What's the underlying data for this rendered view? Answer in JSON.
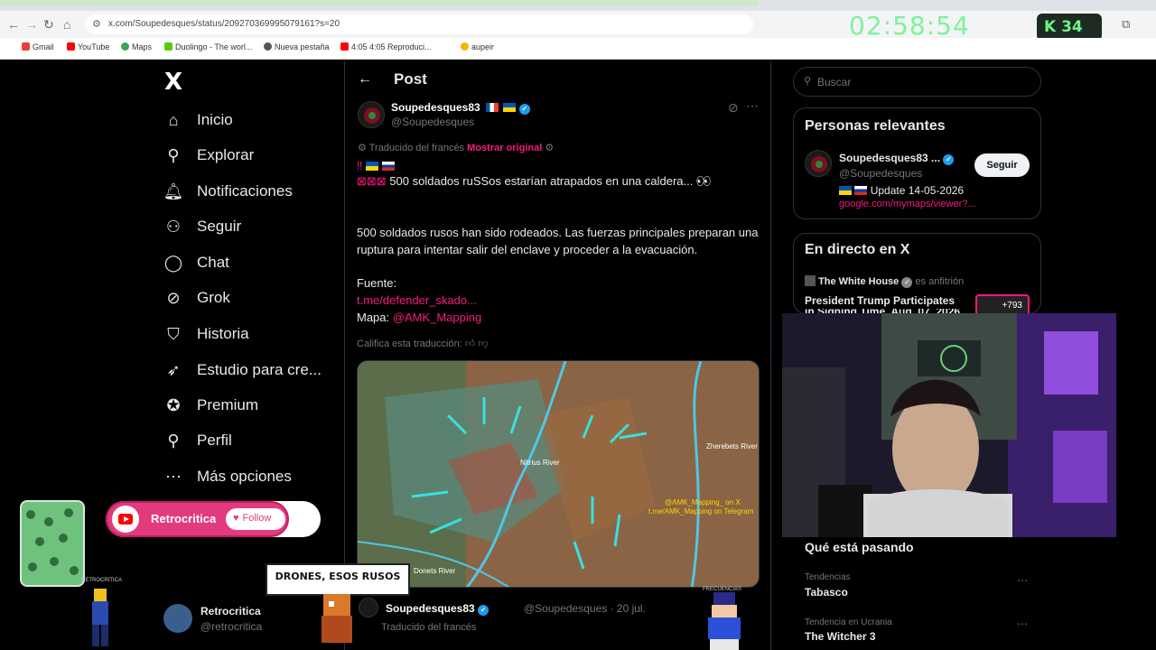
{
  "browser": {
    "url": "x.com/Soupedesques/status/209270369995079161?s=20",
    "timer": "02:58:54",
    "kick_count": "34",
    "bookmarks": [
      "Gmail",
      "YouTube",
      "Maps",
      "Duolingo - The worl...",
      "Nueva pestaña",
      "4:05 4:05 Reproduci...",
      "aupeir"
    ]
  },
  "nav": {
    "logo": "X",
    "items": [
      {
        "label": "Inicio",
        "icon": "home-icon"
      },
      {
        "label": "Explorar",
        "icon": "search-icon"
      },
      {
        "label": "Notificaciones",
        "icon": "bell-icon"
      },
      {
        "label": "Seguir",
        "icon": "follow-icon"
      },
      {
        "label": "Chat",
        "icon": "chat-icon"
      },
      {
        "label": "Grok",
        "icon": "grok-icon"
      },
      {
        "label": "Historia",
        "icon": "bookmark-icon"
      },
      {
        "label": "Estudio para cre...",
        "icon": "rocket-icon"
      },
      {
        "label": "Premium",
        "icon": "verified-icon"
      },
      {
        "label": "Perfil",
        "icon": "person-icon"
      },
      {
        "label": "Más opciones",
        "icon": "more-icon"
      }
    ]
  },
  "post": {
    "header": "Post",
    "author_name": "Soupedesques83",
    "author_handle": "@Soupedesques",
    "translated_from": "Traducido del francés",
    "show_original": "Mostrar original",
    "line1": "500 soldados ruSSos estarían atrapados en una caldera...",
    "line2": "500 soldados rusos han sido rodeados. Las fuerzas principales preparan una ruptura para intentar salir del enclave y proceder a la evacuación.",
    "source_label": "Fuente:",
    "source_link": "t.me/defender_skado...",
    "map_label": "Mapa:",
    "map_link": "@AMK_Mapping",
    "rate_translation": "Califica esta traducción:",
    "map_image": {
      "river_label_1": "Nitrius River",
      "river_label_2": "Zherebets River",
      "river_label_3": "Donets River",
      "watermark_1": "@AMK_Mapping_ on X",
      "watermark_2": "t.me/AMK_Mapping on Telegram"
    },
    "reply": {
      "author_name": "Soupedesques83",
      "handle_date": "@Soupedesques · 20 jul.",
      "translated_from": "Traducido del francés"
    }
  },
  "sidebar": {
    "search_placeholder": "Buscar",
    "relevant": {
      "title": "Personas relevantes",
      "name": "Soupedesques83 ...",
      "handle": "@Soupedesques",
      "bio": "Update 14-05-2026",
      "link": "google.com/mymaps/viewer?...",
      "follow": "Seguir"
    },
    "live": {
      "title": "En directo en X",
      "host": "The White House",
      "host_suffix": "es anfitrión",
      "event": "President Trump Participates",
      "event_line2": "in Signing Time, Aug. 07, 2026",
      "count": "+793"
    },
    "trending": {
      "title": "Qué está pasando",
      "items": [
        {
          "label": "Tendencias",
          "name": "Tabasco"
        },
        {
          "label": "Tendencia en Ucrania",
          "name": "The Witcher 3"
        }
      ]
    }
  },
  "overlay": {
    "yt_channel": "Retrocritica",
    "yt_follow": "Follow",
    "caption": "DRONES, ESOS RUSOS",
    "account_name": "Retrocritica",
    "account_handle": "@retrocritica",
    "glass_label": "RETROCRITICA",
    "goku_label": "FRECUENCIAS"
  },
  "colors": {
    "accent_pink": "#f91880",
    "verified_blue": "#1d9bf0",
    "timer_green": "#7ef29b"
  }
}
